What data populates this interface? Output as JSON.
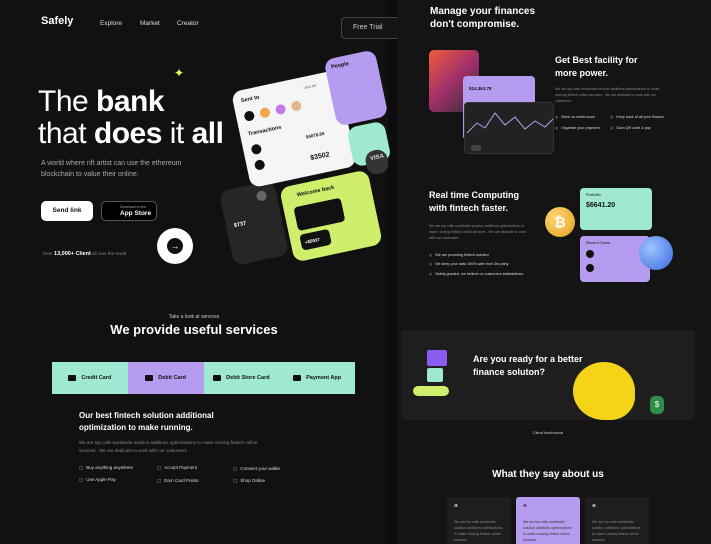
{
  "brand": {
    "logo": "Safely"
  },
  "nav": {
    "items": [
      "Explore",
      "Market",
      "Creator"
    ],
    "cta": "Free Trial"
  },
  "hero": {
    "title_l1_a": "The ",
    "title_l1_b": "bank",
    "title_l2_a": "that ",
    "title_l2_b": "does",
    "title_l2_c": " it ",
    "title_l2_d": "all",
    "subtitle": "A world where nft artist can use the ethereum blockchain to value their online.",
    "send_link": "Send link",
    "store_small": "Download on the",
    "store_label": "App Store",
    "clients_prefix": "Over ",
    "clients_count": "13,000+ Client",
    "clients_suffix": " all over the world"
  },
  "phone_cards": {
    "sent_to": "Sent to",
    "view_all": "View All",
    "transactions": "Transactions",
    "amount1": "$4078.84",
    "amount2": "$3502",
    "people": "People",
    "welcome": "Welcome back",
    "balance": "$737",
    "amount3": "+$5937",
    "visa": "VISA"
  },
  "services": {
    "kicker": "Take a look at services",
    "title": "We provide useful services",
    "tabs": [
      "Credit Card",
      "Debit Card",
      "Debit Store Card",
      "Payment App"
    ],
    "active_tab": 1,
    "best_title": "Our best fintech solution additional optimization to make running.",
    "best_desc": "We are top calls worldwide solution additions optimizations to make running fintech online services . We are dedicate to work with our customers",
    "features": [
      "Buy anything anywhere",
      "Accept Payment",
      "Connect your wallet",
      "Use Apple Pay",
      "Earn Card Points",
      "Shop Online"
    ]
  },
  "right": {
    "manage_title_l1": "Manage your finances",
    "manage_title_l2": "don't compromise.",
    "card_amount": "$14,363.78",
    "facility_title_l1": "Get Best facility for",
    "facility_title_l2": "more power.",
    "facility_desc": "We are top calls worldwide solution additions optimizations to make running fintech online services . We are dedicate to work with our customers",
    "facility_feats": [
      "Work on credit score",
      "Keep track of all your finance",
      "Organise your payment",
      "Scan QR code & pay"
    ],
    "compute_title_l1": "Real time Computing",
    "compute_title_l2": "with fintech faster.",
    "compute_desc": "We are top calls worldwide solution additions optimizations to make running fintech online services . We are dedicate to work with our customers",
    "compute_feats": [
      "We are providing fintech solution",
      "We keep your data 100% safe from 3rd party",
      "Safely granted, we believe on customers satisfactions."
    ],
    "portfolio": "Portfolio",
    "portfolio_amount": "$6641.20",
    "recent": "Recent Trans",
    "banner_title_l1": "Are you ready for a better",
    "banner_title_l2": "finance soluton?",
    "testimonial_kicker": "Client testimonial",
    "testimonial_title": "What they say about us",
    "testimonial_text": "We are top calls worldwide solution additions optimizations to make running fintech online services"
  },
  "colors": {
    "mint": "#9fe8d2",
    "purple": "#b59cf0",
    "lime": "#cfee6b",
    "bg": "#111111"
  }
}
